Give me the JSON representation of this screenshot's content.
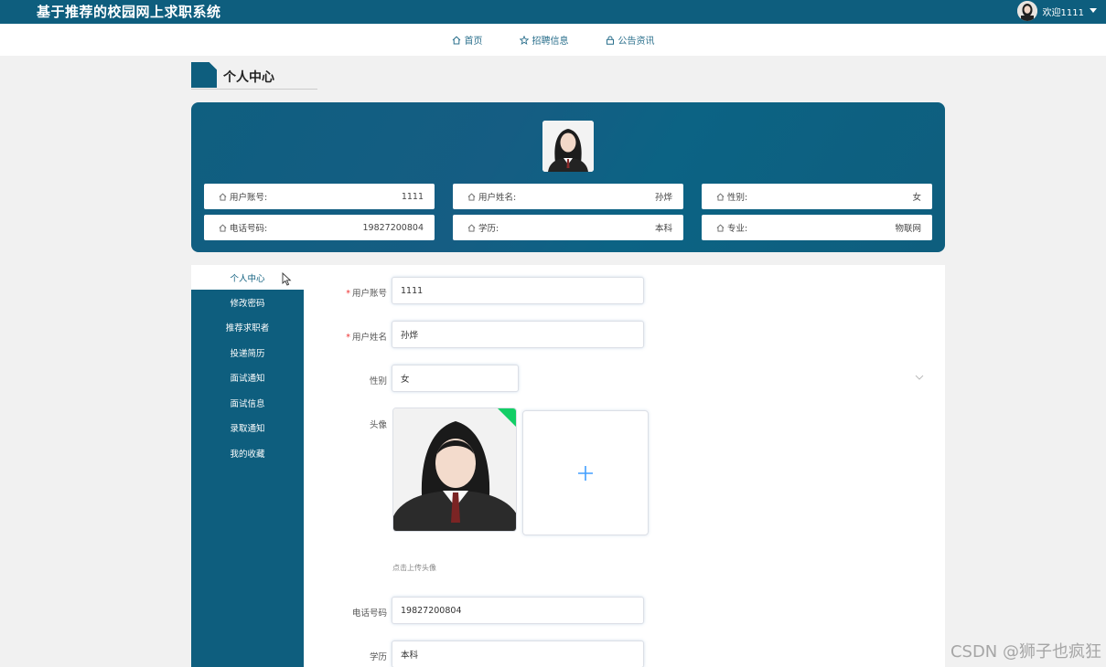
{
  "header": {
    "title": "基于推荐的校园网上求职系统",
    "user_label": "欢迎1111"
  },
  "nav": {
    "items": [
      {
        "label": "首页",
        "icon": "home-icon"
      },
      {
        "label": "招聘信息",
        "icon": "star-icon"
      },
      {
        "label": "公告资讯",
        "icon": "lock-icon"
      }
    ]
  },
  "section": {
    "title": "个人中心"
  },
  "profile": {
    "fields": [
      {
        "label": "用户账号:",
        "value": "1111"
      },
      {
        "label": "用户姓名:",
        "value": "孙烨"
      },
      {
        "label": "性别:",
        "value": "女"
      },
      {
        "label": "电话号码:",
        "value": "19827200804"
      },
      {
        "label": "学历:",
        "value": "本科"
      },
      {
        "label": "专业:",
        "value": "物联网"
      }
    ]
  },
  "sidebar": {
    "items": [
      {
        "label": "个人中心"
      },
      {
        "label": "修改密码"
      },
      {
        "label": "推荐求职者"
      },
      {
        "label": "投递简历"
      },
      {
        "label": "面试通知"
      },
      {
        "label": "面试信息"
      },
      {
        "label": "录取通知"
      },
      {
        "label": "我的收藏"
      }
    ]
  },
  "form": {
    "account_label": "用户账号",
    "account_value": "1111",
    "name_label": "用户姓名",
    "name_value": "孙烨",
    "gender_label": "性别",
    "gender_value": "女",
    "avatar_label": "头像",
    "avatar_hint": "点击上传头像",
    "phone_label": "电话号码",
    "phone_value": "19827200804",
    "edu_label": "学历",
    "edu_value": "本科"
  },
  "watermark": "CSDN @狮子也疯狂",
  "colors": {
    "primary": "#0e5e7e",
    "required": "#e33333",
    "success": "#13ce66",
    "upload_plus": "#409eff"
  }
}
